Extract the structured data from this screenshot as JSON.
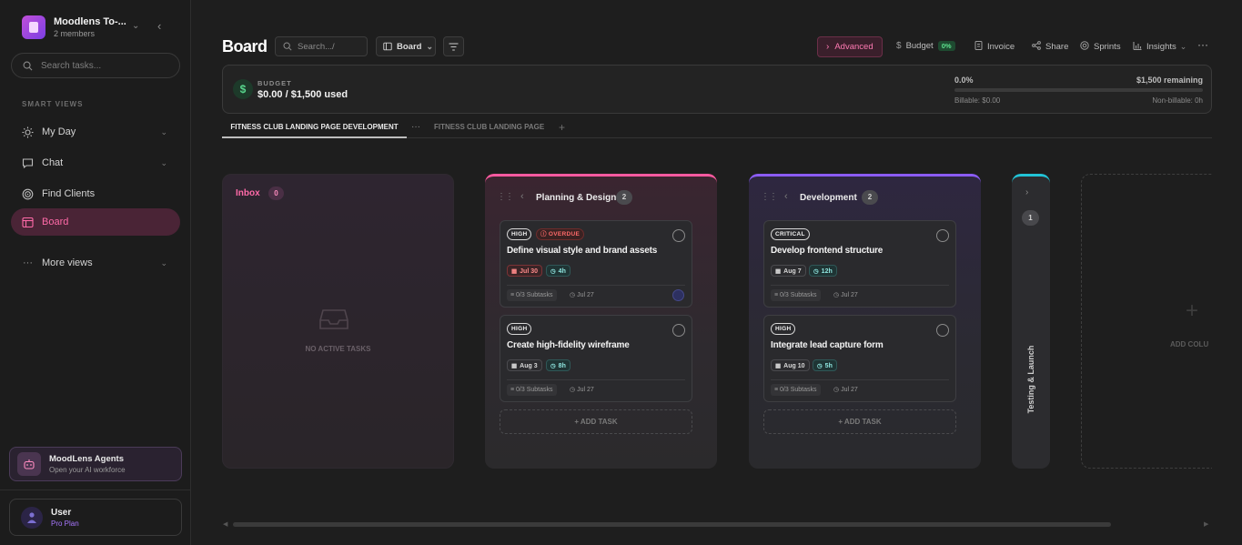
{
  "workspace": {
    "name": "Moodlens To-...",
    "members": "2 members"
  },
  "sidebar": {
    "search_placeholder": "Search tasks...",
    "section_label": "SMART VIEWS",
    "items": [
      {
        "label": "My Day"
      },
      {
        "label": "Chat"
      },
      {
        "label": "Find Clients"
      },
      {
        "label": "Board"
      },
      {
        "label": "More views"
      }
    ],
    "agents": {
      "title": "MoodLens Agents",
      "subtitle": "Open your AI workforce"
    },
    "user": {
      "name": "User",
      "plan": "Pro Plan"
    }
  },
  "header": {
    "title": "Board",
    "search_placeholder": "Search.../",
    "view_label": "Board",
    "advanced_label": "Advanced",
    "budget_label": "Budget",
    "budget_pct": "0%",
    "invoice_label": "Invoice",
    "share_label": "Share",
    "sprints_label": "Sprints",
    "insights_label": "Insights"
  },
  "budget": {
    "label": "BUDGET",
    "used": "$0.00 / $1,500 used",
    "percent": "0.0%",
    "percent_value": 0,
    "remaining": "$1,500 remaining",
    "billable": "Billable: $0.00",
    "nonbillable": "Non-billable: 0h"
  },
  "tabs": [
    {
      "label": "FITNESS CLUB LANDING PAGE DEVELOPMENT"
    },
    {
      "label": "FITNESS CLUB LANDING PAGE"
    }
  ],
  "board": {
    "inbox": {
      "title": "Inbox",
      "count": "0",
      "empty": "NO ACTIVE TASKS"
    },
    "planning": {
      "title": "Planning & Design",
      "count": "2",
      "add_task": "ADD TASK",
      "cards": [
        {
          "priority": "HIGH",
          "overdue": "OVERDUE",
          "title": "Define visual style and brand assets",
          "date": "Jul 30",
          "time": "4h",
          "subtasks": "0/3 Subtasks",
          "due": "Jul 27"
        },
        {
          "priority": "HIGH",
          "title": "Create high-fidelity wireframe",
          "date": "Aug 3",
          "time": "8h",
          "subtasks": "0/3 Subtasks",
          "due": "Jul 27"
        }
      ]
    },
    "development": {
      "title": "Development",
      "count": "2",
      "add_task": "ADD TASK",
      "cards": [
        {
          "priority": "CRITICAL",
          "title": "Develop frontend structure",
          "date": "Aug 7",
          "time": "12h",
          "subtasks": "0/3 Subtasks",
          "due": "Jul 27"
        },
        {
          "priority": "HIGH",
          "title": "Integrate lead capture form",
          "date": "Aug 10",
          "time": "5h",
          "subtasks": "0/3 Subtasks",
          "due": "Jul 27"
        }
      ]
    },
    "testing": {
      "title": "Testing & Launch",
      "count": "1"
    },
    "add_column": "ADD COLU"
  },
  "colors": {
    "accent_pink": "#ff5aa0",
    "accent_purple": "#8b5cf6",
    "accent_cyan": "#22c3d6",
    "money_green": "#5de08d"
  }
}
